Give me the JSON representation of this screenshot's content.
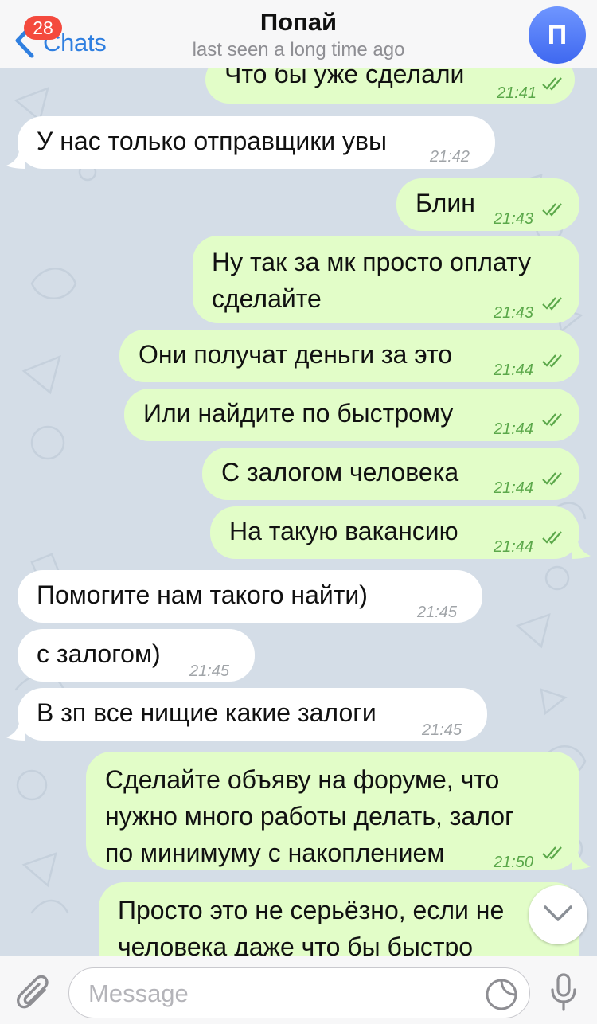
{
  "header": {
    "back_label": "Chats",
    "unread_badge": "28",
    "title": "Попай",
    "subtitle": "last seen a long time ago",
    "avatar_letter": "П"
  },
  "messages": [
    {
      "dir": "out",
      "text": "Что бы уже сделали",
      "time": "21:41",
      "read": true
    },
    {
      "dir": "in",
      "text": "У нас только отправщики увы",
      "time": "21:42"
    },
    {
      "dir": "out",
      "text": "Блин",
      "time": "21:43",
      "read": true
    },
    {
      "dir": "out",
      "text": "Ну так за мк просто оплату\nсделайте",
      "time": "21:43",
      "read": true
    },
    {
      "dir": "out",
      "text": "Они получат деньги за это",
      "time": "21:44",
      "read": true
    },
    {
      "dir": "out",
      "text": "Или найдите по быстрому",
      "time": "21:44",
      "read": true
    },
    {
      "dir": "out",
      "text": "С залогом человека",
      "time": "21:44",
      "read": true
    },
    {
      "dir": "out",
      "text": "На такую вакансию",
      "time": "21:44",
      "read": true
    },
    {
      "dir": "in",
      "text": "Помогите нам такого найти)",
      "time": "21:45"
    },
    {
      "dir": "in",
      "text": "с залогом)",
      "time": "21:45"
    },
    {
      "dir": "in",
      "text": "В зп все нищие какие залоги",
      "time": "21:45"
    },
    {
      "dir": "out",
      "text": "Сделайте объяву на форуме, что\nнужно много работы делать, залог\nпо минимуму с накоплением",
      "time": "21:50",
      "read": true
    },
    {
      "dir": "out",
      "text": "Просто это не серьёзно, если не\nчеловека даже что бы быстро",
      "time": "",
      "read": false
    }
  ],
  "input": {
    "placeholder": "Message",
    "value": ""
  },
  "icons": {
    "back": "chevron-left-icon",
    "attach": "paperclip-icon",
    "sticker": "sticker-icon",
    "mic": "microphone-icon",
    "scroll": "chevron-down-icon",
    "read": "double-check-icon"
  },
  "colors": {
    "accent": "#2f7fe0",
    "badge": "#f44a3e",
    "outgoing_bubble": "#e2fdc8",
    "incoming_bubble": "#ffffff",
    "read_check": "#5ba84a",
    "chat_background": "#d4dde7"
  }
}
